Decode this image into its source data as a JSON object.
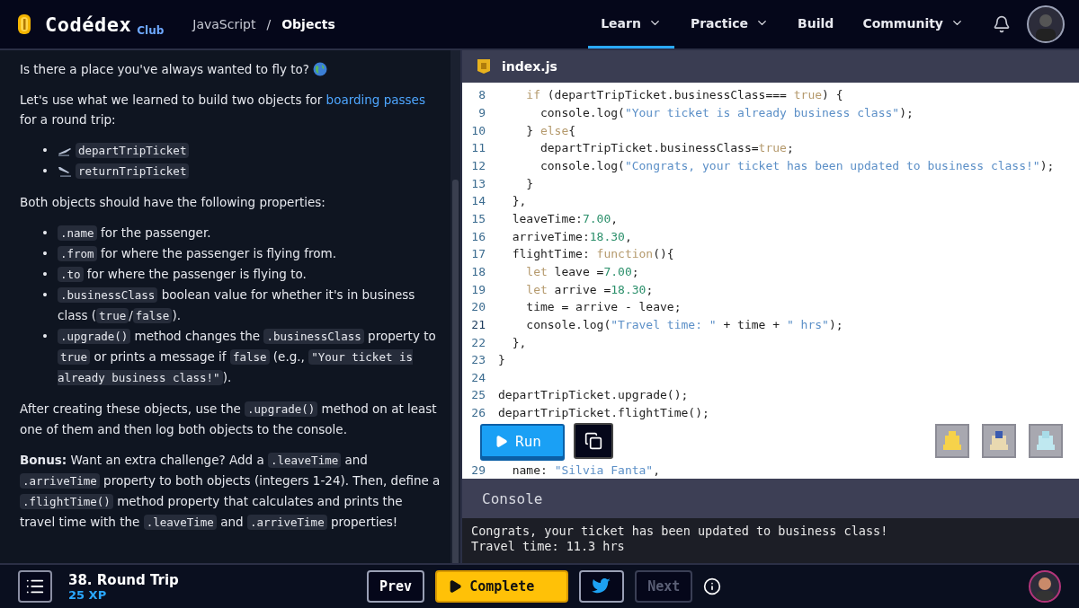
{
  "header": {
    "brand": "Codédex",
    "brand_badge": "Club",
    "breadcrumb": [
      {
        "label": "JavaScript",
        "current": false
      },
      {
        "separator": "/",
        "label": "Objects",
        "current": true
      }
    ],
    "nav": [
      {
        "label": "Learn",
        "dropdown": true,
        "selected": true
      },
      {
        "label": "Practice",
        "dropdown": true,
        "selected": false
      },
      {
        "label": "Build",
        "dropdown": false,
        "selected": false
      },
      {
        "label": "Community",
        "dropdown": true,
        "selected": false
      }
    ]
  },
  "lesson": {
    "blocks": [
      {
        "kind": "para_globe",
        "segments": [
          {
            "kind": "text",
            "text": "Is there a place you've always wanted to fly to?"
          }
        ]
      },
      {
        "kind": "para",
        "segments": [
          {
            "kind": "text",
            "text": "Let's use what we learned to build two objects for "
          },
          {
            "kind": "link",
            "text": "boarding passes"
          },
          {
            "kind": "text",
            "text": " for a round trip:"
          }
        ]
      },
      {
        "kind": "list",
        "items": [
          {
            "kind": "takeoff",
            "bullet": "•",
            "segments": [
              {
                "kind": "code",
                "text": "departTripTicket"
              }
            ]
          },
          {
            "kind": "landing",
            "bullet": "•",
            "segments": [
              {
                "kind": "code",
                "text": "returnTripTicket"
              }
            ]
          }
        ]
      },
      {
        "kind": "para",
        "segments": [
          {
            "kind": "text",
            "text": "Both objects should have the following properties:"
          }
        ]
      },
      {
        "kind": "list",
        "items": [
          {
            "kind": "plain",
            "bullet": "•",
            "segments": [
              {
                "kind": "code",
                "text": ".name"
              },
              {
                "kind": "text",
                "text": " for the passenger."
              }
            ]
          },
          {
            "kind": "plain",
            "bullet": "•",
            "segments": [
              {
                "kind": "code",
                "text": ".from"
              },
              {
                "kind": "text",
                "text": " for where the passenger is flying from."
              }
            ]
          },
          {
            "kind": "plain",
            "bullet": "•",
            "segments": [
              {
                "kind": "code",
                "text": ".to"
              },
              {
                "kind": "text",
                "text": " for where the passenger is flying to."
              }
            ]
          },
          {
            "kind": "plain",
            "bullet": "•",
            "segments": [
              {
                "kind": "code",
                "text": ".businessClass"
              },
              {
                "kind": "text",
                "text": " boolean value for whether it's in business class ("
              },
              {
                "kind": "code",
                "text": "true"
              },
              {
                "kind": "text",
                "text": "/"
              },
              {
                "kind": "code",
                "text": "false"
              },
              {
                "kind": "text",
                "text": ")."
              }
            ]
          },
          {
            "kind": "plain",
            "bullet": "•",
            "segments": [
              {
                "kind": "code",
                "text": ".upgrade()"
              },
              {
                "kind": "text",
                "text": " method changes the "
              },
              {
                "kind": "code",
                "text": ".businessClass"
              },
              {
                "kind": "text",
                "text": " property to "
              },
              {
                "kind": "code",
                "text": "true"
              },
              {
                "kind": "text",
                "text": " or prints a message if "
              },
              {
                "kind": "code",
                "text": "false"
              },
              {
                "kind": "text",
                "text": " (e.g., "
              },
              {
                "kind": "code",
                "text": "\"Your ticket is already business class!\""
              },
              {
                "kind": "text",
                "text": ")."
              }
            ]
          }
        ]
      },
      {
        "kind": "para",
        "segments": [
          {
            "kind": "text",
            "text": "After creating these objects, use the "
          },
          {
            "kind": "code",
            "text": ".upgrade()"
          },
          {
            "kind": "text",
            "text": " method on at least one of them and then log both objects to the console."
          }
        ]
      },
      {
        "kind": "para",
        "segments": [
          {
            "kind": "bold",
            "text": "Bonus:"
          },
          {
            "kind": "text",
            "text": " Want an extra challenge? Add a "
          },
          {
            "kind": "code",
            "text": ".leaveTime"
          },
          {
            "kind": "text",
            "text": " and "
          },
          {
            "kind": "code",
            "text": ".arriveTime"
          },
          {
            "kind": "text",
            "text": " property to both objects (integers 1-24). Then, define a "
          },
          {
            "kind": "code",
            "text": ".flightTime()"
          },
          {
            "kind": "text",
            "text": " method property that calculates and prints the travel time with the "
          },
          {
            "kind": "code",
            "text": ".leaveTime"
          },
          {
            "kind": "text",
            "text": " and "
          },
          {
            "kind": "code",
            "text": ".arriveTime"
          },
          {
            "kind": "text",
            "text": " properties!"
          }
        ]
      }
    ]
  },
  "editor": {
    "filename": "index.js",
    "lines": [
      {
        "number": "8",
        "active": false,
        "tokens": [
          {
            "kind": "kw",
            "text": "    if"
          },
          {
            "kind": "plain",
            "text": " (departTripTicket.businessClass=== "
          },
          {
            "kind": "kw",
            "text": "true"
          },
          {
            "kind": "plain",
            "text": ") {"
          }
        ]
      },
      {
        "number": "9",
        "active": false,
        "tokens": [
          {
            "kind": "plain",
            "text": "      console.log("
          },
          {
            "kind": "str",
            "text": "\"Your ticket is already business class\""
          },
          {
            "kind": "plain",
            "text": ");"
          }
        ]
      },
      {
        "number": "10",
        "active": false,
        "tokens": [
          {
            "kind": "plain",
            "text": "    } "
          },
          {
            "kind": "kw",
            "text": "else"
          },
          {
            "kind": "plain",
            "text": "{"
          }
        ]
      },
      {
        "number": "11",
        "active": false,
        "tokens": [
          {
            "kind": "plain",
            "text": "      departTripTicket.businessClass="
          },
          {
            "kind": "kw",
            "text": "true"
          },
          {
            "kind": "plain",
            "text": ";"
          }
        ]
      },
      {
        "number": "12",
        "active": false,
        "tokens": [
          {
            "kind": "plain",
            "text": "      console.log("
          },
          {
            "kind": "str",
            "text": "\"Congrats, your ticket has been updated to business class!\""
          },
          {
            "kind": "plain",
            "text": ");"
          }
        ]
      },
      {
        "number": "13",
        "active": false,
        "tokens": [
          {
            "kind": "plain",
            "text": "    }"
          }
        ]
      },
      {
        "number": "14",
        "active": false,
        "tokens": [
          {
            "kind": "plain",
            "text": "  },"
          }
        ]
      },
      {
        "number": "15",
        "active": false,
        "tokens": [
          {
            "kind": "plain",
            "text": "  leaveTime:"
          },
          {
            "kind": "num",
            "text": "7.00"
          },
          {
            "kind": "plain",
            "text": ","
          }
        ]
      },
      {
        "number": "16",
        "active": false,
        "tokens": [
          {
            "kind": "plain",
            "text": "  arriveTime:"
          },
          {
            "kind": "num",
            "text": "18.30"
          },
          {
            "kind": "plain",
            "text": ","
          }
        ]
      },
      {
        "number": "17",
        "active": false,
        "tokens": [
          {
            "kind": "plain",
            "text": "  flightTime: "
          },
          {
            "kind": "kw",
            "text": "function"
          },
          {
            "kind": "plain",
            "text": "(){"
          }
        ]
      },
      {
        "number": "18",
        "active": false,
        "tokens": [
          {
            "kind": "kw",
            "text": "    let"
          },
          {
            "kind": "plain",
            "text": " leave ="
          },
          {
            "kind": "num",
            "text": "7.00"
          },
          {
            "kind": "plain",
            "text": ";"
          }
        ]
      },
      {
        "number": "19",
        "active": false,
        "tokens": [
          {
            "kind": "kw",
            "text": "    let"
          },
          {
            "kind": "plain",
            "text": " arrive ="
          },
          {
            "kind": "num",
            "text": "18.30"
          },
          {
            "kind": "plain",
            "text": ";"
          }
        ]
      },
      {
        "number": "20",
        "active": false,
        "tokens": [
          {
            "kind": "plain",
            "text": "    time = arrive - leave;"
          }
        ]
      },
      {
        "number": "21",
        "active": true,
        "tokens": [
          {
            "kind": "plain",
            "text": "    console.log("
          },
          {
            "kind": "str",
            "text": "\"Travel time: \""
          },
          {
            "kind": "plain",
            "text": " + time + "
          },
          {
            "kind": "str",
            "text": "\" hrs\""
          },
          {
            "kind": "plain",
            "text": ");"
          }
        ]
      },
      {
        "number": "22",
        "active": false,
        "tokens": [
          {
            "kind": "plain",
            "text": "  },"
          }
        ]
      },
      {
        "number": "23",
        "active": false,
        "tokens": [
          {
            "kind": "plain",
            "text": "}"
          }
        ]
      },
      {
        "number": "24",
        "active": false
      },
      {
        "number": "25",
        "active": false,
        "tokens": [
          {
            "kind": "plain",
            "text": "departTripTicket.upgrade();"
          }
        ]
      },
      {
        "number": "26",
        "active": false,
        "tokens": [
          {
            "kind": "plain",
            "text": "departTripTicket.flightTime();"
          }
        ]
      }
    ],
    "after_toolbar": [
      {
        "number": "29",
        "active": false,
        "tokens": [
          {
            "kind": "plain",
            "text": "  name: "
          },
          {
            "kind": "str",
            "text": "\"Silvia Fanta\""
          },
          {
            "kind": "plain",
            "text": ","
          }
        ]
      }
    ],
    "run_label": "Run"
  },
  "console": {
    "title": "Console",
    "output": [
      "Congrats, your ticket has been updated to business class!",
      "Travel time: 11.3 hrs"
    ]
  },
  "footer": {
    "lesson_title": "38. Round Trip",
    "xp": "25 XP",
    "prev": "Prev",
    "complete": "Complete",
    "next": "Next",
    "next_disabled": true
  }
}
